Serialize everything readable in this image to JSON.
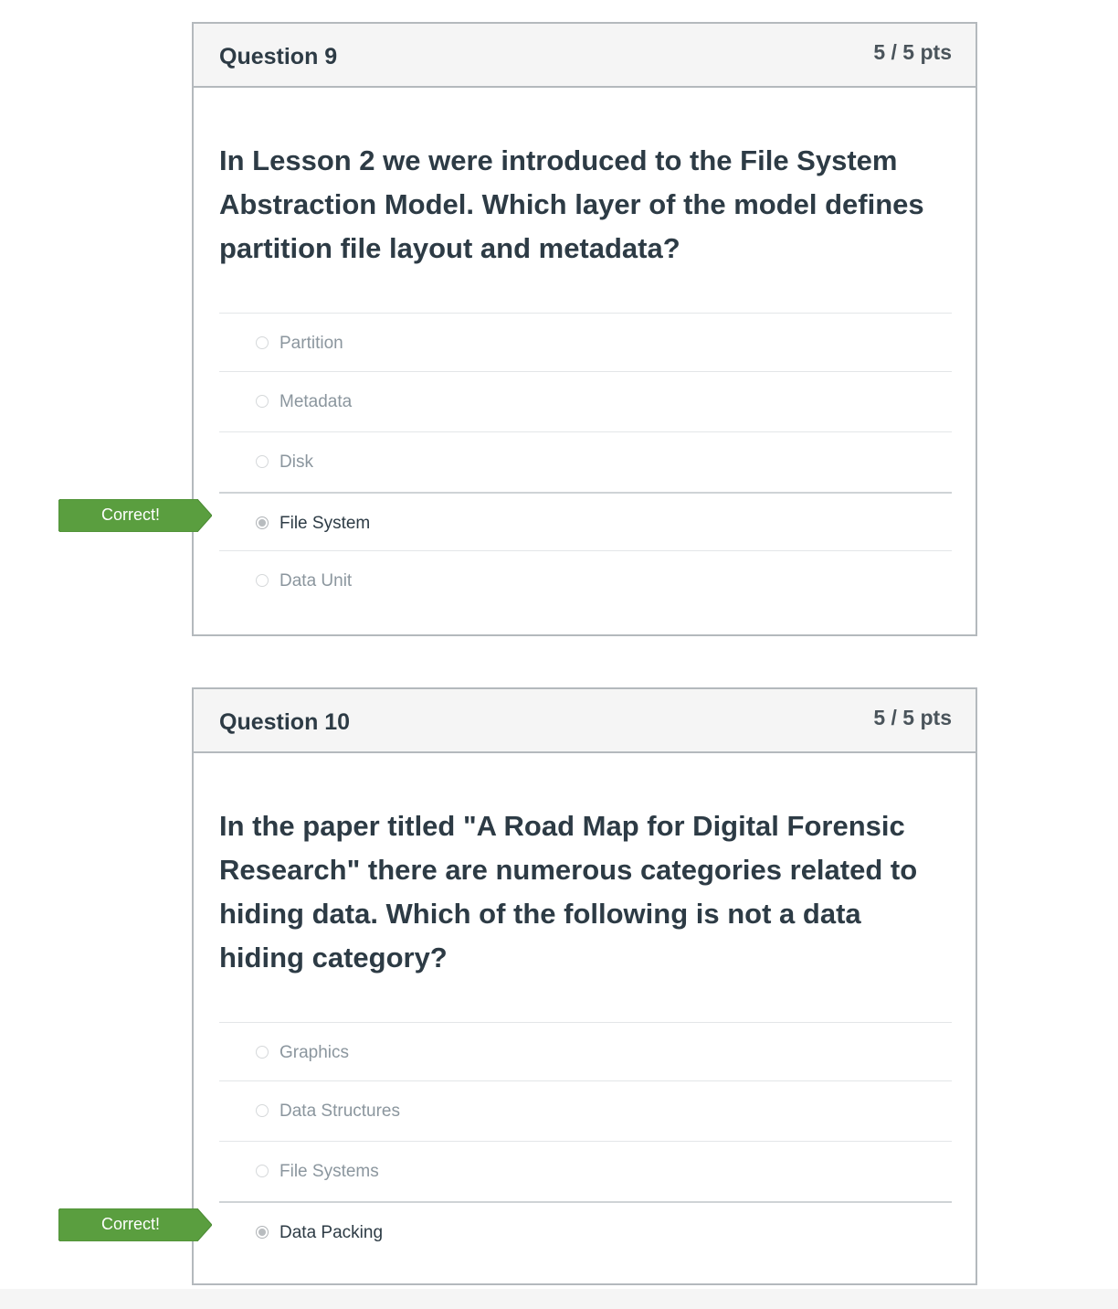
{
  "questions": [
    {
      "title": "Question 9",
      "points": "5 / 5 pts",
      "text": "In Lesson 2 we were introduced to the File System Abstraction Model. Which layer of the model defines partition file layout and metadata?",
      "answers": [
        {
          "label": "Partition",
          "selected": false
        },
        {
          "label": "Metadata",
          "selected": false
        },
        {
          "label": "Disk",
          "selected": false
        },
        {
          "label": "File System",
          "selected": true
        },
        {
          "label": "Data Unit",
          "selected": false
        }
      ],
      "result_label": "Correct!"
    },
    {
      "title": "Question 10",
      "points": "5 / 5 pts",
      "text": "In the paper titled \"A Road Map for Digital Forensic Research\" there are numerous categories related to hiding data. Which of the following is not a data hiding category?",
      "answers": [
        {
          "label": "Graphics",
          "selected": false
        },
        {
          "label": "Data Structures",
          "selected": false
        },
        {
          "label": "File Systems",
          "selected": false
        },
        {
          "label": "Data Packing",
          "selected": true
        }
      ],
      "result_label": "Correct!"
    }
  ],
  "colors": {
    "correct_flag": "#5a9e3f",
    "header_bg": "#f5f5f5",
    "text": "#2d3b45",
    "muted_text": "#8b969e"
  }
}
